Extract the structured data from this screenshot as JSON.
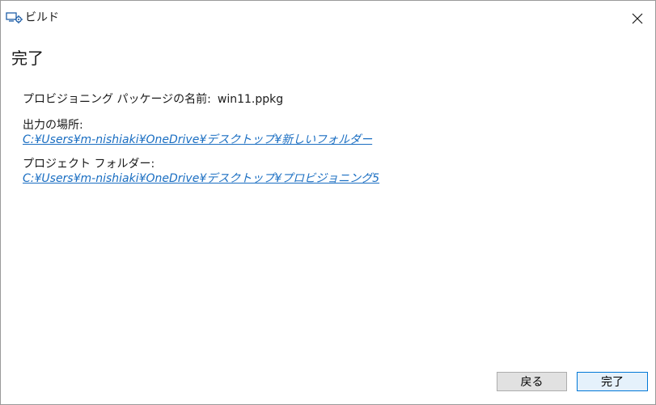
{
  "window": {
    "title": "ビルド",
    "icon": "build-gear-icon"
  },
  "page": {
    "title": "完了"
  },
  "package": {
    "label": "プロビジョニング パッケージの名前:",
    "value": "win11.ppkg"
  },
  "output": {
    "label": "出力の場所:",
    "path": "C:¥Users¥m-nishiaki¥OneDrive¥デスクトップ¥新しいフォルダー"
  },
  "project": {
    "label": "プロジェクト フォルダー:",
    "path": "C:¥Users¥m-nishiaki¥OneDrive¥デスクトップ¥プロビジョニング5"
  },
  "buttons": {
    "back": "戻る",
    "finish": "完了"
  },
  "colors": {
    "link": "#1a6ec2",
    "accent": "#0078d7"
  }
}
